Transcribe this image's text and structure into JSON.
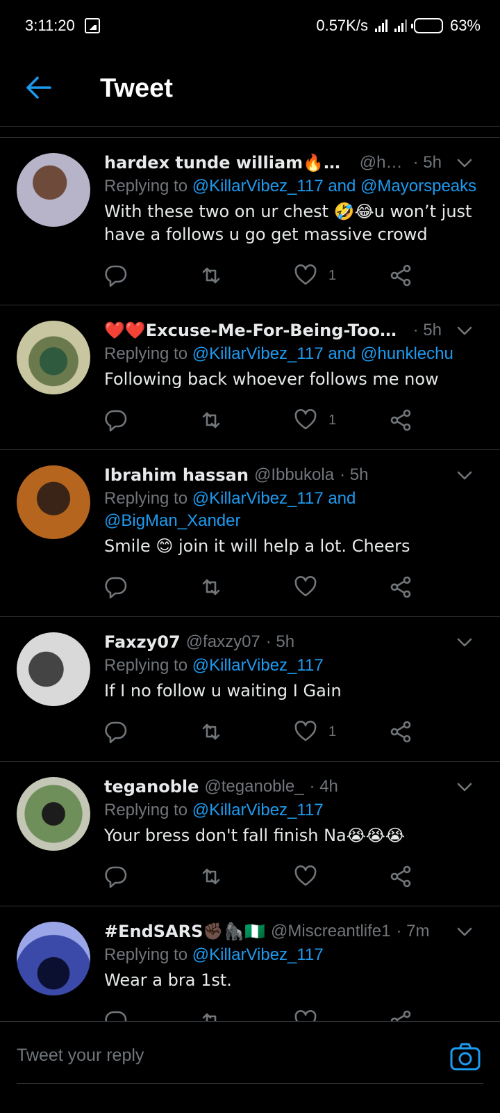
{
  "status_bar": {
    "time": "3:11:20",
    "speed": "0.57K/s",
    "battery": "63%",
    "battery_level": 0.63
  },
  "header": {
    "title": "Tweet",
    "back_icon": "arrow-left-icon"
  },
  "colors": {
    "accent": "#1d9bf0",
    "background": "#000000",
    "muted": "#71767b",
    "text": "#e7e9ea"
  },
  "tweets": [
    {
      "name": "hardex tunde william🔥🔥💗💔",
      "handle": "@har...",
      "time": "· 5h",
      "reply_prefix": "Replying to ",
      "reply_mentions": "@KillarVibez_117 and @Mayorspeaks",
      "text": "With these two on ur chest 🤣😂u won’t just have a follows u go get massive crowd",
      "likes": "1"
    },
    {
      "name": "❤️❤️Excuse-Me-For-Being-Too-Soci...",
      "handle": "",
      "time": "· 5h",
      "reply_prefix": "Replying to ",
      "reply_mentions": "@KillarVibez_117 and @hunklechu",
      "text": "Following back whoever follows me now",
      "likes": "1"
    },
    {
      "name": "Ibrahim hassan",
      "handle": "@Ibbukola",
      "time": "· 5h",
      "reply_prefix": "Replying to ",
      "reply_mentions": "@KillarVibez_117 and @BigMan_Xander",
      "text": "Smile 😊 join it will help a lot. Cheers",
      "likes": ""
    },
    {
      "name": "Faxzy07",
      "handle": "@faxzy07",
      "time": "· 5h",
      "reply_prefix": "Replying to ",
      "reply_mentions": "@KillarVibez_117",
      "text": "If I no follow u waiting I Gain",
      "likes": "1"
    },
    {
      "name": "teganoble",
      "handle": "@teganoble_",
      "time": "· 4h",
      "reply_prefix": "Replying to ",
      "reply_mentions": "@KillarVibez_117",
      "text": "Your bress don't fall finish Na😭😭😭",
      "likes": ""
    },
    {
      "name": "#EndSARS✊🏿🦍🇳🇬",
      "handle": "@Miscreantlife1",
      "time": "· 7m",
      "reply_prefix": "Replying to ",
      "reply_mentions": "@KillarVibez_117",
      "text": "Wear a bra 1st.",
      "likes": ""
    }
  ],
  "reply_bar": {
    "placeholder": "Tweet your reply",
    "camera_icon": "camera-icon"
  }
}
